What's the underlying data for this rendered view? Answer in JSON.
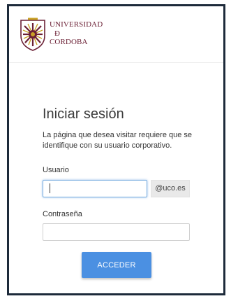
{
  "header": {
    "logo_icon": "university-crest-icon",
    "logo_lines": [
      "UNIVERSIDAD",
      "Ð",
      "CORDOBA"
    ],
    "logo_color": "#6b2035"
  },
  "login": {
    "title": "Iniciar sesión",
    "subtitle": "La página que desea visitar requiere que se identifique con su usuario corporativo.",
    "username_label": "Usuario",
    "username_value": "",
    "username_suffix": "@uco.es",
    "password_label": "Contraseña",
    "password_value": "",
    "submit_label": "ACCEDER",
    "accent_color": "#4b90e2"
  }
}
